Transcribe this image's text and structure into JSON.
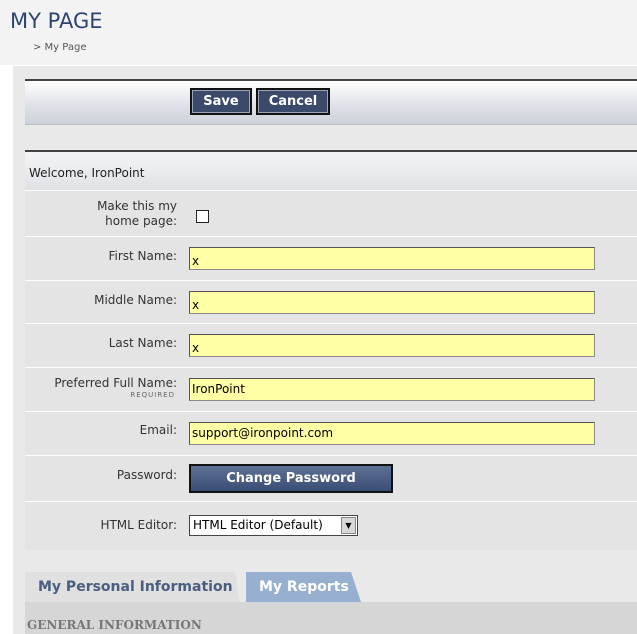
{
  "header": {
    "title": "MY PAGE",
    "breadcrumb": "> My Page"
  },
  "toolbar": {
    "save_label": "Save",
    "cancel_label": "Cancel"
  },
  "form": {
    "welcome": "Welcome, IronPoint",
    "home_page": {
      "label_line1": "Make this my",
      "label_line2": "home page:",
      "checked": false
    },
    "first_name": {
      "label": "First Name:",
      "value": "x"
    },
    "middle_name": {
      "label": "Middle Name:",
      "value": "x"
    },
    "last_name": {
      "label": "Last Name:",
      "value": "x"
    },
    "preferred_full_name": {
      "label": "Preferred Full Name:",
      "required": "REQUIRED",
      "value": "IronPoint"
    },
    "email": {
      "label": "Email:",
      "value": "support@ironpoint.com"
    },
    "password": {
      "label": "Password:",
      "button": "Change Password"
    },
    "html_editor": {
      "label": "HTML Editor:",
      "selected": "HTML Editor (Default)"
    }
  },
  "tabs": [
    {
      "label": "My Personal Information",
      "active": true
    },
    {
      "label": "My Reports",
      "active": false
    }
  ],
  "section": {
    "title": "GENERAL INFORMATION"
  },
  "colors": {
    "title": "#2e4470",
    "input_bg": "#ffffa5",
    "button_bg": "#3b4a6b",
    "active_tab_text": "#4a5e80",
    "inactive_tab_bg": "#98b0d0"
  }
}
